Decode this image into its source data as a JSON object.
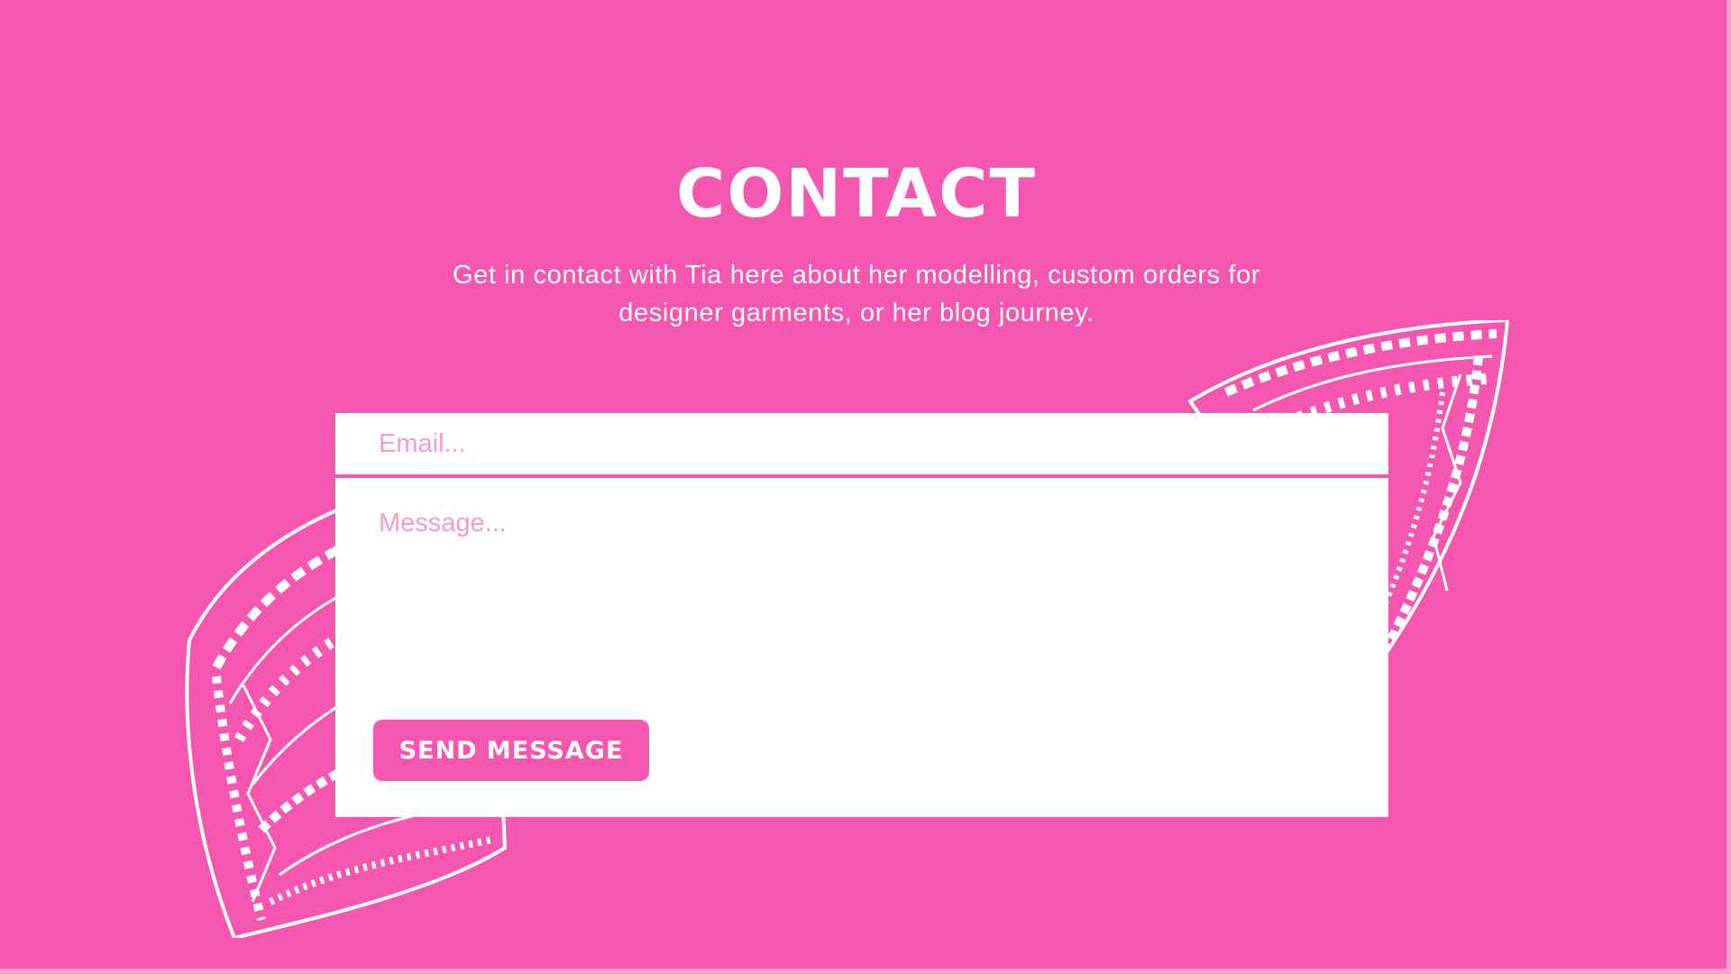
{
  "contact": {
    "title": "CONTACT",
    "description": "Get in contact with Tia here about her modelling, custom orders for designer garments, or her blog journey."
  },
  "form": {
    "email_placeholder": "Email...",
    "message_placeholder": "Message...",
    "submit_label": "SEND MESSAGE"
  },
  "colors": {
    "background": "#f456b0",
    "card": "#ffffff",
    "placeholder": "#f49ad0"
  }
}
